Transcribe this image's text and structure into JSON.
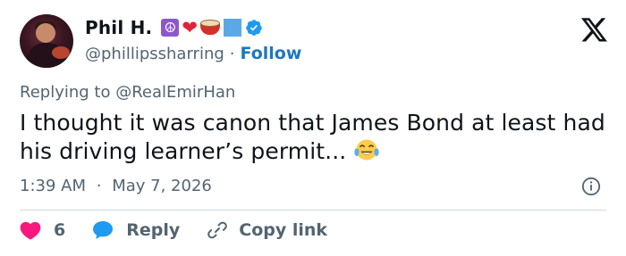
{
  "author": {
    "name": "Phil H.",
    "handle": "@phillipssharring",
    "separator": "·",
    "follow_label": "Follow",
    "name_emojis": [
      "peace-icon",
      "heart-icon",
      "drum-icon",
      "blue-square-icon"
    ],
    "verified_icon": "verified-badge-icon"
  },
  "platform_logo": "x-logo-icon",
  "reply_context": {
    "prefix": "Replying to",
    "mention": "@RealEmirHan"
  },
  "tweet": {
    "text": "I thought it was canon that James Bond at least had his driving learner’s permit...",
    "emoji": "face-with-tears-of-joy-icon"
  },
  "meta": {
    "time": "1:39 AM",
    "separator": "·",
    "date": "May 7, 2026",
    "info_icon": "info-icon"
  },
  "actions": {
    "like_count": "6",
    "reply_label": "Reply",
    "copy_label": "Copy link"
  },
  "colors": {
    "accent": "#1d9bf0",
    "follow_text": "#1d77c2",
    "like": "#f91880",
    "muted_text": "#536471",
    "divider": "#cfd9de"
  }
}
